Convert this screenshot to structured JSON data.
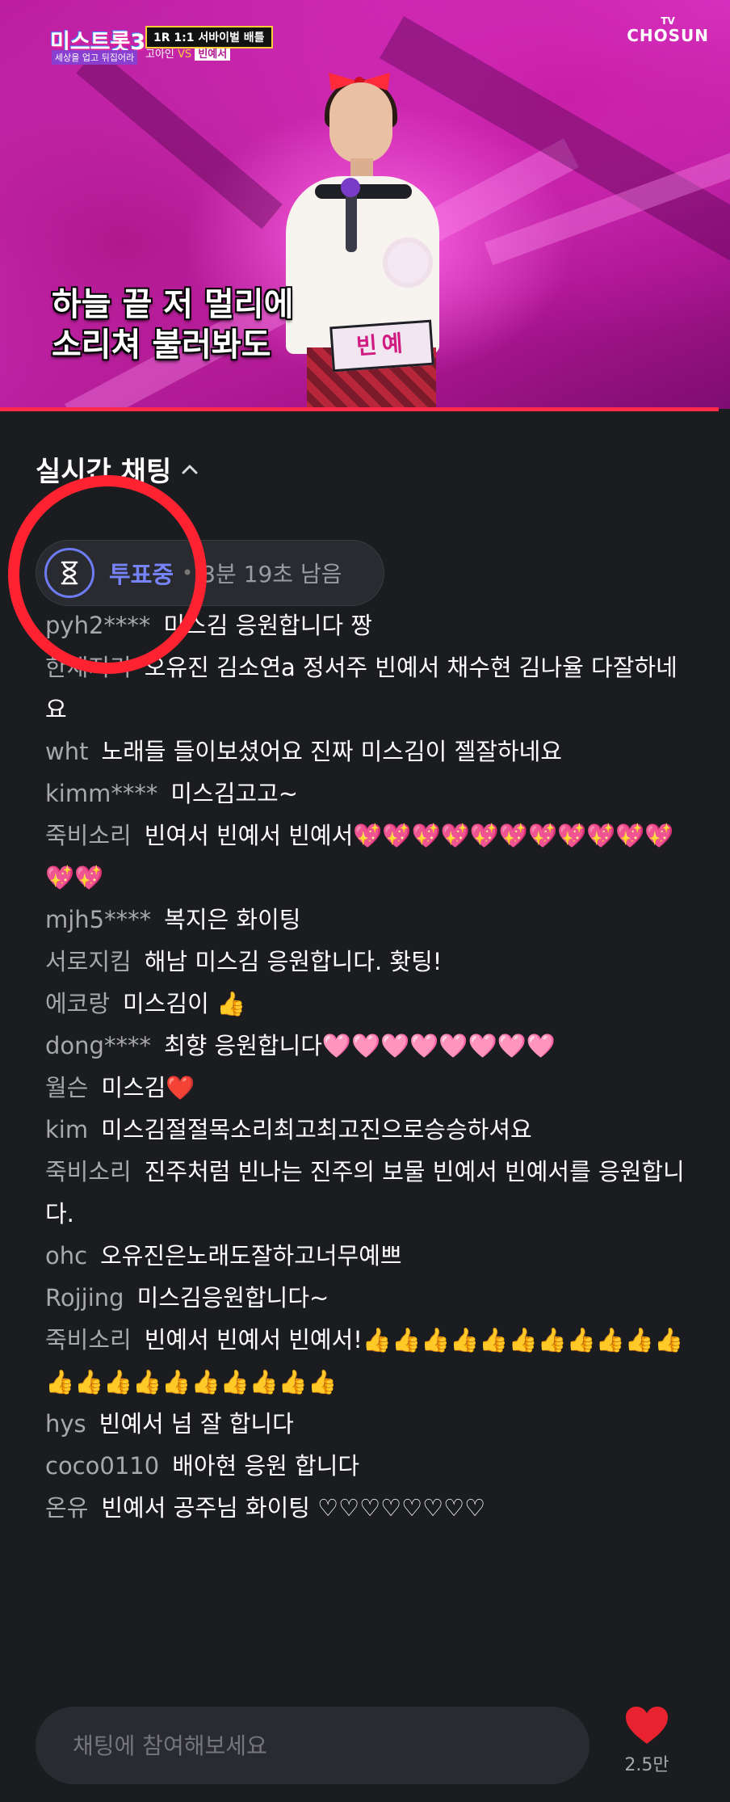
{
  "video": {
    "show_logo": "미스트롯3",
    "show_logo_sub": "세상을 업고 뒤집어라",
    "round_badge": "1R 1:1 서바이벌 배틀",
    "contestant_a": "고아인",
    "vs_label": "VS",
    "contestant_b": "빈예서",
    "channel_tv": "TV",
    "channel_name": "CHOSUN",
    "caption_line1": "하늘 끝 저 멀리에",
    "caption_line2": "소리쳐 불러봐도",
    "name_tag": "빈예",
    "progress": 0.985
  },
  "chat": {
    "title": "실시간 채팅",
    "vote": {
      "status": "투표중",
      "separator": "•",
      "remaining": "3분 19초 남음"
    },
    "messages": [
      {
        "user": "pyh2****",
        "text": "미스김 응원합니다 짱"
      },
      {
        "user": "한채지기",
        "text": "오유진 김소연a 정서주 빈예서 채수현 김나율 다잘하네요"
      },
      {
        "user": "wht",
        "text": "노래들 들이보셨어요 진짜 미스김이 젤잘하네요"
      },
      {
        "user": "kimm****",
        "text": "미스김고고~"
      },
      {
        "user": "죽비소리",
        "text": "빈여서 빈예서 빈예서💖💖💖💖💖💖💖💖💖💖💖💖💖"
      },
      {
        "user": "mjh5****",
        "text": "복지은 화이팅"
      },
      {
        "user": "서로지킴",
        "text": "해남 미스김 응원합니다. 홧팅!"
      },
      {
        "user": "에코랑",
        "text": "미스김이 👍"
      },
      {
        "user": "dong****",
        "text": "최향 응원합니다🩷🩷🩷🩷🩷🩷🩷🩷"
      },
      {
        "user": "월슨",
        "text": "미스김❤️"
      },
      {
        "user": "kim",
        "text": "미스김절절목소리최고최고진으로승승하셔요"
      },
      {
        "user": "죽비소리",
        "text": "진주처럼 빈나는 진주의 보물 빈예서 빈예서를 응원합니다."
      },
      {
        "user": "ohc",
        "text": "오유진은노래도잘하고너무예쁘"
      },
      {
        "user": "Rojjing",
        "text": "미스김응원합니다~"
      },
      {
        "user": "죽비소리",
        "text": "빈예서 빈예서 빈예서!👍👍👍👍👍👍👍👍👍👍👍👍👍👍👍👍👍👍👍👍👍"
      },
      {
        "user": "hys",
        "text": "빈예서 넘 잘 합니다"
      },
      {
        "user": "coco0110",
        "text": "배아현 응원 합니다"
      },
      {
        "user": "온유",
        "text": "빈예서 공주님 화이팅 ♡♡♡♡♡♡♡♡"
      }
    ],
    "input_placeholder": "채팅에 참여해보세요",
    "like_count": "2.5만"
  },
  "colors": {
    "background": "#1b1c20",
    "accent_vote": "#7784f9",
    "like_red": "#e8232f",
    "annotation_red": "#ff2332"
  },
  "icons": [
    "chevron-up-icon",
    "hourglass-icon",
    "heart-icon"
  ]
}
